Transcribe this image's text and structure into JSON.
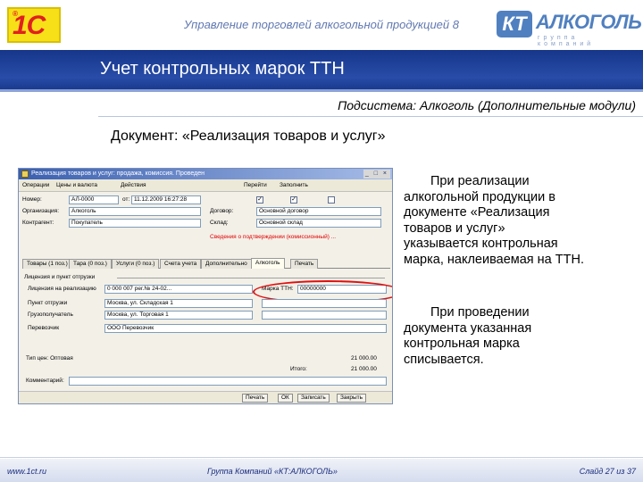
{
  "header": {
    "title": "Управление торговлей алкогольной продукцией 8",
    "logo_1c": "1С",
    "logo_kt_box": "КТ",
    "logo_kt_name": "АЛКОГОЛЬ",
    "logo_kt_sub": "группа компаний"
  },
  "band": {
    "title": "Учет контрольных марок ТТН"
  },
  "subsystem": "Подсистема: Алкоголь (Дополнительные модули)",
  "document_title": "Документ: «Реализация товаров и услуг»",
  "window": {
    "title": "Реализация товаров и услуг: продажа, комиссия. Проведен",
    "toolbar": [
      "Операции",
      "Цены и валюта",
      "Действия",
      "Перейти",
      "Заполнить"
    ],
    "fields": {
      "nomer_label": "Номер:",
      "nomer_value": "АЛ-0000",
      "ot_label": "от:",
      "ot_value": "11.12.2009 16:27:28",
      "org_label": "Организация:",
      "org_value": "Алкоголь",
      "kontr_label": "Контрагент:",
      "kontr_value": "Покупатель",
      "dogovor_label": "Договор:",
      "dogovor_value": "Основной договор",
      "sklad_label": "Склад:",
      "sklad_value": "Основной склад",
      "red_note": "Сведения о подтверждении (комиссионный) ..."
    },
    "tabs": [
      "Товары (1 поз.)",
      "Тара (0 поз.)",
      "Услуги (0 поз.)",
      "Счета учета",
      "Дополнительно",
      "Алкоголь",
      "Печать"
    ],
    "group_label": "Лицензия и пункт отгрузки",
    "alc_rows": [
      {
        "label": "Лицензия на реализацию",
        "value": "0 000 007 рег.№ 24-02..."
      },
      {
        "label": "Пункт отгрузки",
        "value": "Москва, ул. Складская 1"
      },
      {
        "label": "Грузополучатель",
        "value": "Москва, ул. Торговая 1"
      },
      {
        "label": "Перевозчик",
        "value": "ООО Перевозчик"
      }
    ],
    "marka_label": "Марка ТТН:",
    "marka_value": "00000000",
    "totals": [
      {
        "label": "Тип цен: Оптовая",
        "value": "21 000.00"
      },
      {
        "label": "Итого:",
        "value": "21 000.00"
      }
    ],
    "comment_label": "Комментарий:",
    "buttons": [
      "Печать",
      "ОК",
      "Записать",
      "Закрыть"
    ]
  },
  "paragraphs": [
    [
      "При реализации",
      "алкогольной продукции в",
      "документе «Реализация",
      "товаров и услуг»",
      "указывается контрольная",
      "марка, наклеиваемая на ТТН."
    ],
    [
      "При проведении",
      "документа указанная",
      "контрольная марка",
      "списывается."
    ]
  ],
  "footer": {
    "left": "www.1ct.ru",
    "middle": "Группа Компаний «КТ:АЛКОГОЛЬ»",
    "right": "Слайд 27 из 37"
  }
}
